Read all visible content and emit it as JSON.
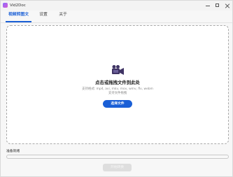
{
  "app": {
    "title": "Vid2Doc",
    "icon": "app-logo"
  },
  "window_controls": {
    "minimize_icon": "minimize-icon",
    "maximize_icon": "maximize-icon",
    "close_icon": "close-icon"
  },
  "tabs": [
    {
      "label": "视频转图文",
      "active": true
    },
    {
      "label": "设置",
      "active": false
    },
    {
      "label": "关于",
      "active": false
    }
  ],
  "dropzone": {
    "icon": "video-camera-icon",
    "title": "点击或拖拽文件到此处",
    "formats": "支持格式: mp4, avi, mkv, mov, wmv, flv, webm",
    "hint": "支持文件拖拽",
    "button_label": "选择文件"
  },
  "status": {
    "label": "准备就绪",
    "progress": 0
  },
  "start_button": {
    "label": "开始转换",
    "enabled": false
  },
  "colors": {
    "accent": "#1a5fd6",
    "background": "#f7f7f7",
    "disabled_button": "#dedede"
  }
}
